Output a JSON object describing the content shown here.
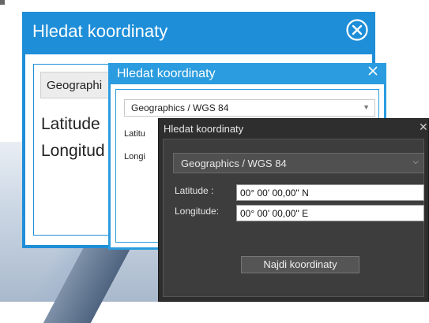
{
  "dialogs": [
    {
      "title": "Hledat koordinaty",
      "combo_value": "Geographi",
      "latitude_label": "Latitude",
      "longitude_label": "Longitud"
    },
    {
      "title": "Hledat koordinaty",
      "combo_value": "Geographics / WGS 84",
      "latitude_label": "Latitu",
      "longitude_label": "Longi"
    },
    {
      "title": "Hledat koordinaty",
      "combo_value": "Geographics / WGS 84",
      "latitude_label": "Latitude   :",
      "longitude_label": "Longitude:",
      "latitude_value": "00° 00' 00,00\" N",
      "longitude_value": "00° 00' 00,00\" E",
      "button_label": "Najdi koordinaty"
    }
  ],
  "colors": {
    "accent": "#1e8ed8",
    "dark_background": "#2e2e2e"
  }
}
